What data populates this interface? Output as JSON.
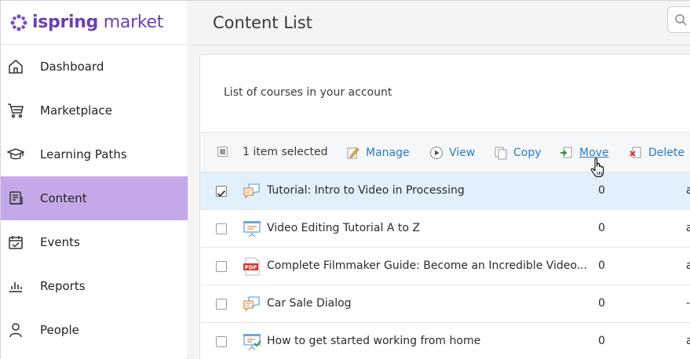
{
  "app": {
    "logo_text_bold": "ispring",
    "logo_text_light": " market"
  },
  "sidebar": {
    "items": [
      {
        "label": "Dashboard",
        "icon": "home-icon"
      },
      {
        "label": "Marketplace",
        "icon": "cart-icon"
      },
      {
        "label": "Learning Paths",
        "icon": "graduation-cap-icon"
      },
      {
        "label": "Content",
        "icon": "document-icon",
        "active": true
      },
      {
        "label": "Events",
        "icon": "calendar-check-icon"
      },
      {
        "label": "Reports",
        "icon": "bar-chart-icon"
      },
      {
        "label": "People",
        "icon": "person-icon"
      }
    ]
  },
  "header": {
    "title": "Content List"
  },
  "main": {
    "subtitle": "List of courses in your account",
    "toolbar": {
      "selected_text": "1 item selected",
      "actions": [
        {
          "label": "Manage",
          "icon": "edit-icon"
        },
        {
          "label": "View",
          "icon": "play-icon"
        },
        {
          "label": "Copy",
          "icon": "copy-icon"
        },
        {
          "label": "Move",
          "icon": "move-icon"
        },
        {
          "label": "Delete",
          "icon": "delete-icon"
        }
      ]
    },
    "rows": [
      {
        "title": "Tutorial: Intro to Video in Processing",
        "count": "0",
        "extra": "a",
        "type": "dialog",
        "checked": true
      },
      {
        "title": "Video Editing Tutorial A to Z",
        "count": "0",
        "extra": "a",
        "type": "presentation",
        "checked": false
      },
      {
        "title": "Complete Filmmaker Guide: Become an Incredible Video...",
        "count": "0",
        "extra": "a",
        "type": "pdf",
        "checked": false
      },
      {
        "title": "Car Sale Dialog",
        "count": "0",
        "extra": "-",
        "type": "dialog",
        "checked": false
      },
      {
        "title": "How to get started working from home",
        "count": "0",
        "extra": "a",
        "type": "quiz-presentation",
        "checked": false
      }
    ]
  },
  "colors": {
    "brand": "#6b3fb3",
    "active_nav": "#c4a9e8",
    "link": "#2a7ac0",
    "selected_row": "#e2f0fb"
  }
}
